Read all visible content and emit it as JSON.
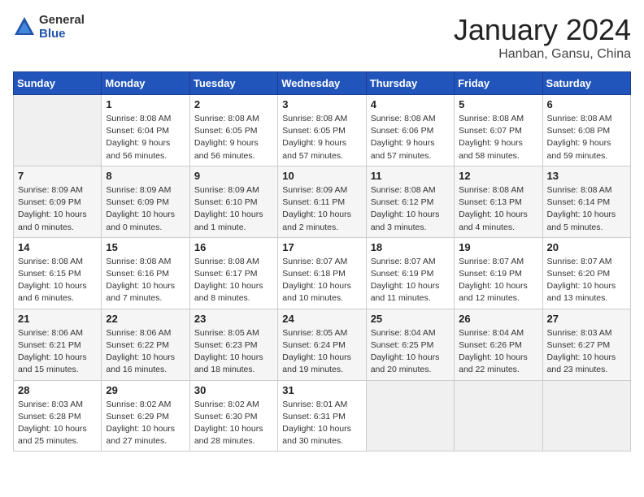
{
  "header": {
    "logo_general": "General",
    "logo_blue": "Blue",
    "month_title": "January 2024",
    "location": "Hanban, Gansu, China"
  },
  "calendar": {
    "days_of_week": [
      "Sunday",
      "Monday",
      "Tuesday",
      "Wednesday",
      "Thursday",
      "Friday",
      "Saturday"
    ],
    "weeks": [
      [
        {
          "day": "",
          "info": ""
        },
        {
          "day": "1",
          "info": "Sunrise: 8:08 AM\nSunset: 6:04 PM\nDaylight: 9 hours\nand 56 minutes."
        },
        {
          "day": "2",
          "info": "Sunrise: 8:08 AM\nSunset: 6:05 PM\nDaylight: 9 hours\nand 56 minutes."
        },
        {
          "day": "3",
          "info": "Sunrise: 8:08 AM\nSunset: 6:05 PM\nDaylight: 9 hours\nand 57 minutes."
        },
        {
          "day": "4",
          "info": "Sunrise: 8:08 AM\nSunset: 6:06 PM\nDaylight: 9 hours\nand 57 minutes."
        },
        {
          "day": "5",
          "info": "Sunrise: 8:08 AM\nSunset: 6:07 PM\nDaylight: 9 hours\nand 58 minutes."
        },
        {
          "day": "6",
          "info": "Sunrise: 8:08 AM\nSunset: 6:08 PM\nDaylight: 9 hours\nand 59 minutes."
        }
      ],
      [
        {
          "day": "7",
          "info": "Sunrise: 8:09 AM\nSunset: 6:09 PM\nDaylight: 10 hours\nand 0 minutes."
        },
        {
          "day": "8",
          "info": "Sunrise: 8:09 AM\nSunset: 6:09 PM\nDaylight: 10 hours\nand 0 minutes."
        },
        {
          "day": "9",
          "info": "Sunrise: 8:09 AM\nSunset: 6:10 PM\nDaylight: 10 hours\nand 1 minute."
        },
        {
          "day": "10",
          "info": "Sunrise: 8:09 AM\nSunset: 6:11 PM\nDaylight: 10 hours\nand 2 minutes."
        },
        {
          "day": "11",
          "info": "Sunrise: 8:08 AM\nSunset: 6:12 PM\nDaylight: 10 hours\nand 3 minutes."
        },
        {
          "day": "12",
          "info": "Sunrise: 8:08 AM\nSunset: 6:13 PM\nDaylight: 10 hours\nand 4 minutes."
        },
        {
          "day": "13",
          "info": "Sunrise: 8:08 AM\nSunset: 6:14 PM\nDaylight: 10 hours\nand 5 minutes."
        }
      ],
      [
        {
          "day": "14",
          "info": "Sunrise: 8:08 AM\nSunset: 6:15 PM\nDaylight: 10 hours\nand 6 minutes."
        },
        {
          "day": "15",
          "info": "Sunrise: 8:08 AM\nSunset: 6:16 PM\nDaylight: 10 hours\nand 7 minutes."
        },
        {
          "day": "16",
          "info": "Sunrise: 8:08 AM\nSunset: 6:17 PM\nDaylight: 10 hours\nand 8 minutes."
        },
        {
          "day": "17",
          "info": "Sunrise: 8:07 AM\nSunset: 6:18 PM\nDaylight: 10 hours\nand 10 minutes."
        },
        {
          "day": "18",
          "info": "Sunrise: 8:07 AM\nSunset: 6:19 PM\nDaylight: 10 hours\nand 11 minutes."
        },
        {
          "day": "19",
          "info": "Sunrise: 8:07 AM\nSunset: 6:19 PM\nDaylight: 10 hours\nand 12 minutes."
        },
        {
          "day": "20",
          "info": "Sunrise: 8:07 AM\nSunset: 6:20 PM\nDaylight: 10 hours\nand 13 minutes."
        }
      ],
      [
        {
          "day": "21",
          "info": "Sunrise: 8:06 AM\nSunset: 6:21 PM\nDaylight: 10 hours\nand 15 minutes."
        },
        {
          "day": "22",
          "info": "Sunrise: 8:06 AM\nSunset: 6:22 PM\nDaylight: 10 hours\nand 16 minutes."
        },
        {
          "day": "23",
          "info": "Sunrise: 8:05 AM\nSunset: 6:23 PM\nDaylight: 10 hours\nand 18 minutes."
        },
        {
          "day": "24",
          "info": "Sunrise: 8:05 AM\nSunset: 6:24 PM\nDaylight: 10 hours\nand 19 minutes."
        },
        {
          "day": "25",
          "info": "Sunrise: 8:04 AM\nSunset: 6:25 PM\nDaylight: 10 hours\nand 20 minutes."
        },
        {
          "day": "26",
          "info": "Sunrise: 8:04 AM\nSunset: 6:26 PM\nDaylight: 10 hours\nand 22 minutes."
        },
        {
          "day": "27",
          "info": "Sunrise: 8:03 AM\nSunset: 6:27 PM\nDaylight: 10 hours\nand 23 minutes."
        }
      ],
      [
        {
          "day": "28",
          "info": "Sunrise: 8:03 AM\nSunset: 6:28 PM\nDaylight: 10 hours\nand 25 minutes."
        },
        {
          "day": "29",
          "info": "Sunrise: 8:02 AM\nSunset: 6:29 PM\nDaylight: 10 hours\nand 27 minutes."
        },
        {
          "day": "30",
          "info": "Sunrise: 8:02 AM\nSunset: 6:30 PM\nDaylight: 10 hours\nand 28 minutes."
        },
        {
          "day": "31",
          "info": "Sunrise: 8:01 AM\nSunset: 6:31 PM\nDaylight: 10 hours\nand 30 minutes."
        },
        {
          "day": "",
          "info": ""
        },
        {
          "day": "",
          "info": ""
        },
        {
          "day": "",
          "info": ""
        }
      ]
    ]
  }
}
